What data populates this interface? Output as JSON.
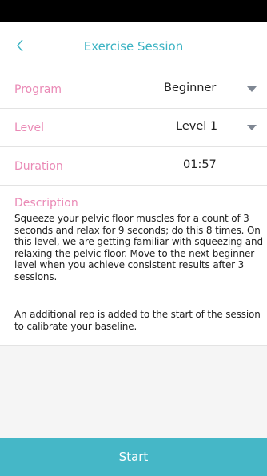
{
  "header": {
    "title": "Exercise Session",
    "back_icon": "chevron-left-icon"
  },
  "program": {
    "label": "Program",
    "value": "Beginner",
    "icon": "caret-down-icon"
  },
  "level": {
    "label": "Level",
    "value": "Level 1",
    "icon": "caret-down-icon"
  },
  "duration": {
    "label": "Duration",
    "value": "01:57"
  },
  "description": {
    "label": "Description",
    "text": "Squeeze your pelvic floor muscles for a count of 3 seconds and relax for 9 seconds; do this 8 times. On this level, we are getting familiar with squeezing and relaxing the pelvic floor. Move to the next beginner level when you achieve consistent results after 3 sessions.",
    "note": "An additional rep is added to the start of the session to calibrate your baseline."
  },
  "actions": {
    "start_label": "Start"
  },
  "colors": {
    "accent": "#45b7c7",
    "title": "#3bb3c3",
    "label": "#ea8ab6",
    "caret": "#7f8793",
    "filler": "#f5f5f5"
  }
}
